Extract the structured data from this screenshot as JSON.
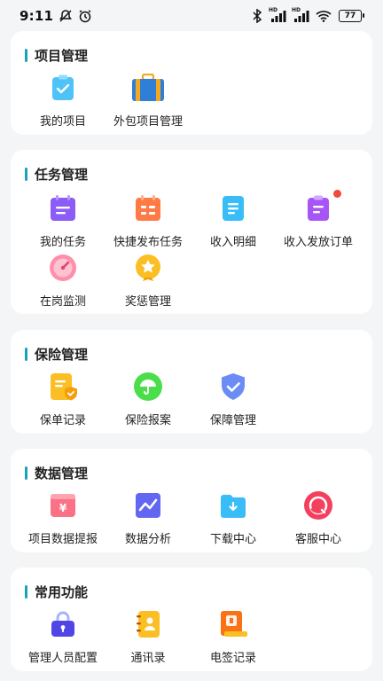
{
  "status_bar": {
    "time": "9:11",
    "battery": "77",
    "signal_badge_1": "HD",
    "signal_badge_2": "HD"
  },
  "sections": [
    {
      "title": "项目管理",
      "items": [
        {
          "label": "我的项目",
          "icon": "clipboard-check-icon"
        },
        {
          "label": "外包项目管理",
          "icon": "briefcase-icon"
        }
      ]
    },
    {
      "title": "任务管理",
      "items": [
        {
          "label": "我的任务",
          "icon": "calendar-list-icon"
        },
        {
          "label": "快捷发布任务",
          "icon": "calendar-publish-icon"
        },
        {
          "label": "收入明细",
          "icon": "document-list-icon"
        },
        {
          "label": "收入发放订单",
          "icon": "order-clipboard-icon"
        },
        {
          "label": "在岗监测",
          "icon": "gauge-icon"
        },
        {
          "label": "奖惩管理",
          "icon": "star-medal-icon"
        }
      ]
    },
    {
      "title": "保险管理",
      "items": [
        {
          "label": "保单记录",
          "icon": "policy-shield-icon"
        },
        {
          "label": "保险报案",
          "icon": "umbrella-icon"
        },
        {
          "label": "保障管理",
          "icon": "shield-check-icon"
        }
      ]
    },
    {
      "title": "数据管理",
      "items": [
        {
          "label": "项目数据提报",
          "icon": "yuan-wallet-icon"
        },
        {
          "label": "数据分析",
          "icon": "line-chart-icon"
        },
        {
          "label": "下载中心",
          "icon": "download-folder-icon"
        },
        {
          "label": "客服中心",
          "icon": "customer-service-icon"
        }
      ]
    },
    {
      "title": "常用功能",
      "items": [
        {
          "label": "管理人员配置",
          "icon": "lock-user-icon"
        },
        {
          "label": "通讯录",
          "icon": "contacts-book-icon"
        },
        {
          "label": "电签记录",
          "icon": "e-sign-icon"
        }
      ]
    }
  ],
  "colors": {
    "accent": "#1aa3b8",
    "badge": "#f04b3a",
    "background": "#f4f5f7"
  }
}
